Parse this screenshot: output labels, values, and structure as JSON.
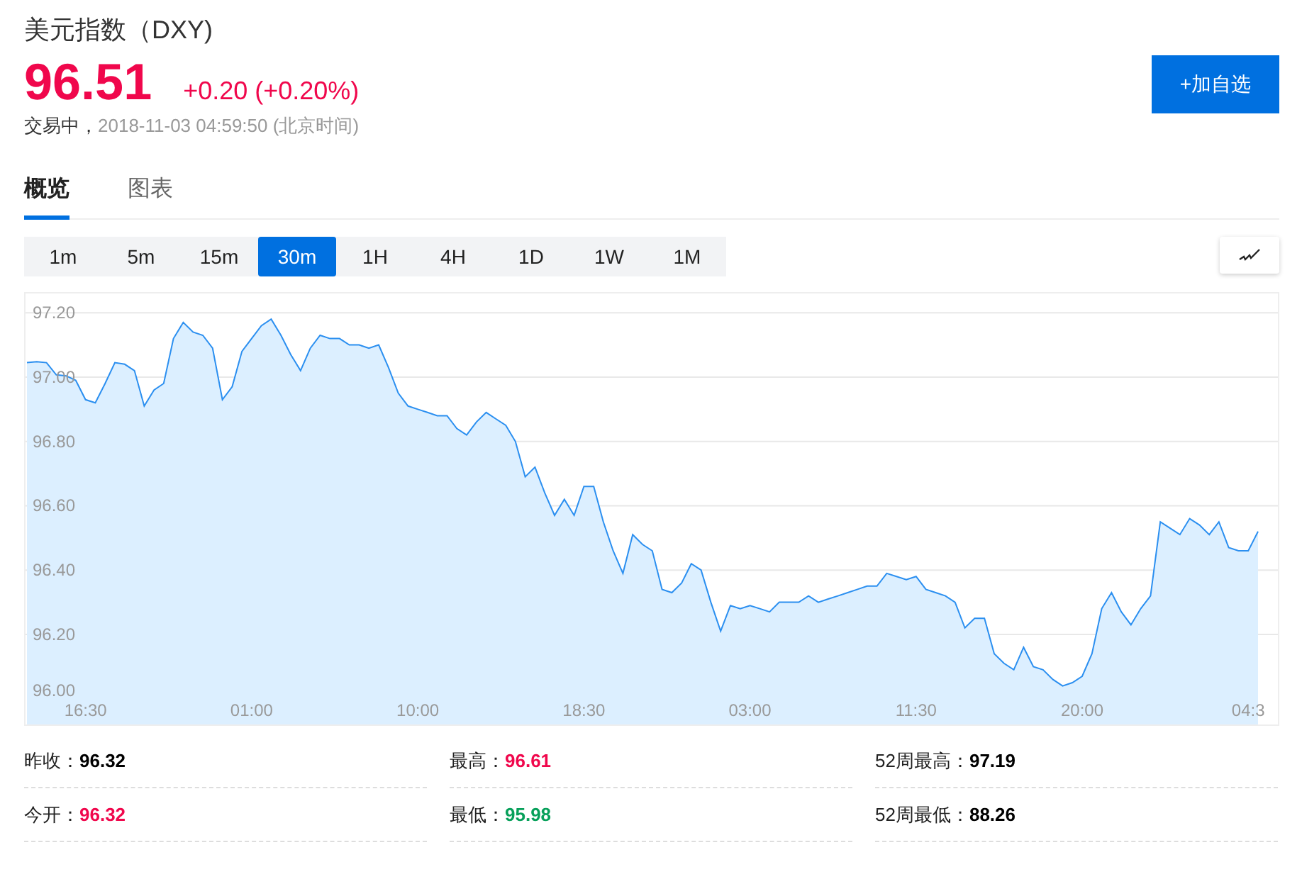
{
  "header": {
    "title": "美元指数（DXY)",
    "price": "96.51",
    "change": "+0.20 (+0.20%)",
    "status": "交易中，",
    "timestamp": "2018-11-03 04:59:50 (北京时间)",
    "button": "+加自选"
  },
  "tabs": [
    {
      "label": "概览",
      "selected": true
    },
    {
      "label": "图表",
      "selected": false
    }
  ],
  "intervals": [
    {
      "label": "1m",
      "selected": false
    },
    {
      "label": "5m",
      "selected": false
    },
    {
      "label": "15m",
      "selected": false
    },
    {
      "label": "30m",
      "selected": true
    },
    {
      "label": "1H",
      "selected": false
    },
    {
      "label": "4H",
      "selected": false
    },
    {
      "label": "1D",
      "selected": false
    },
    {
      "label": "1W",
      "selected": false
    },
    {
      "label": "1M",
      "selected": false
    }
  ],
  "chart": {
    "chart_data": {
      "type": "area",
      "categories": [
        null,
        null,
        null,
        null,
        null,
        null,
        "16:30",
        null,
        null,
        null,
        null,
        null,
        null,
        null,
        null,
        null,
        null,
        null,
        null,
        null,
        null,
        null,
        null,
        "01:00",
        null,
        null,
        null,
        null,
        null,
        null,
        null,
        null,
        null,
        null,
        null,
        null,
        null,
        null,
        null,
        null,
        "10:00",
        null,
        null,
        null,
        null,
        null,
        null,
        null,
        null,
        null,
        null,
        null,
        null,
        null,
        null,
        null,
        null,
        "18:30",
        null,
        null,
        null,
        null,
        null,
        null,
        null,
        null,
        null,
        null,
        null,
        null,
        null,
        null,
        null,
        null,
        "03:00",
        null,
        null,
        null,
        null,
        null,
        null,
        null,
        null,
        null,
        null,
        null,
        null,
        null,
        null,
        null,
        null,
        "11:30",
        null,
        null,
        null,
        null,
        null,
        null,
        null,
        null,
        null,
        null,
        null,
        null,
        null,
        null,
        null,
        null,
        "20:00",
        null,
        null,
        null,
        null,
        null,
        null,
        null,
        null,
        null,
        null,
        null,
        null,
        null,
        null,
        null,
        null,
        "04:3",
        null
      ],
      "series": [
        {
          "color": "#2b8ff0",
          "values": [
            97.045,
            97.048,
            97.045,
            97.007,
            97.004,
            96.99,
            96.93,
            96.92,
            96.98,
            97.045,
            97.04,
            97.02,
            96.91,
            96.96,
            96.98,
            97.12,
            97.17,
            97.14,
            97.13,
            97.09,
            96.93,
            96.97,
            97.08,
            97.12,
            97.16,
            97.18,
            97.13,
            97.07,
            97.02,
            97.09,
            97.13,
            97.12,
            97.12,
            97.1,
            97.1,
            97.09,
            97.1,
            97.03,
            96.95,
            96.91,
            96.9,
            96.89,
            96.88,
            96.88,
            96.84,
            96.82,
            96.86,
            96.89,
            96.87,
            96.85,
            96.8,
            96.69,
            96.72,
            96.64,
            96.57,
            96.62,
            96.57,
            96.66,
            96.66,
            96.55,
            96.46,
            96.39,
            96.51,
            96.48,
            96.46,
            96.34,
            96.33,
            96.36,
            96.42,
            96.4,
            96.3,
            96.21,
            96.29,
            96.28,
            96.29,
            96.28,
            96.27,
            96.3,
            96.3,
            96.3,
            96.32,
            96.3,
            96.31,
            96.32,
            96.33,
            96.34,
            96.35,
            96.35,
            96.39,
            96.38,
            96.37,
            96.38,
            96.34,
            96.33,
            96.32,
            96.3,
            96.22,
            96.25,
            96.25,
            96.14,
            96.11,
            96.09,
            96.16,
            96.1,
            96.09,
            96.06,
            96.04,
            96.05,
            96.07,
            96.14,
            96.28,
            96.33,
            96.27,
            96.23,
            96.28,
            96.32,
            96.55,
            96.53,
            96.51,
            96.56,
            96.54,
            96.51,
            96.55,
            96.47,
            96.46,
            96.46,
            96.52
          ]
        }
      ],
      "ylim": [
        95.92,
        97.26
      ],
      "grid": true,
      "yticks": [
        {
          "value": 96.0,
          "label": "96.00"
        },
        {
          "value": 96.2,
          "label": "96.20"
        },
        {
          "value": 96.4,
          "label": "96.40"
        },
        {
          "value": 96.6,
          "label": "96.60"
        },
        {
          "value": 96.8,
          "label": "96.80"
        },
        {
          "value": 97.0,
          "label": "97.00"
        },
        {
          "value": 97.2,
          "label": "97.20"
        }
      ]
    }
  },
  "stats": [
    {
      "label": "昨收：",
      "value": "96.32",
      "color": "#000000"
    },
    {
      "label": "最高：",
      "value": "96.61",
      "color": "#f0074c"
    },
    {
      "label": "52周最高：",
      "value": "97.19",
      "color": "#000000"
    },
    {
      "label": "今开：",
      "value": "96.32",
      "color": "#f0074c"
    },
    {
      "label": "最低：",
      "value": "95.98",
      "color": "#07a05a"
    },
    {
      "label": "52周最低：",
      "value": "88.26",
      "color": "#000000"
    }
  ]
}
